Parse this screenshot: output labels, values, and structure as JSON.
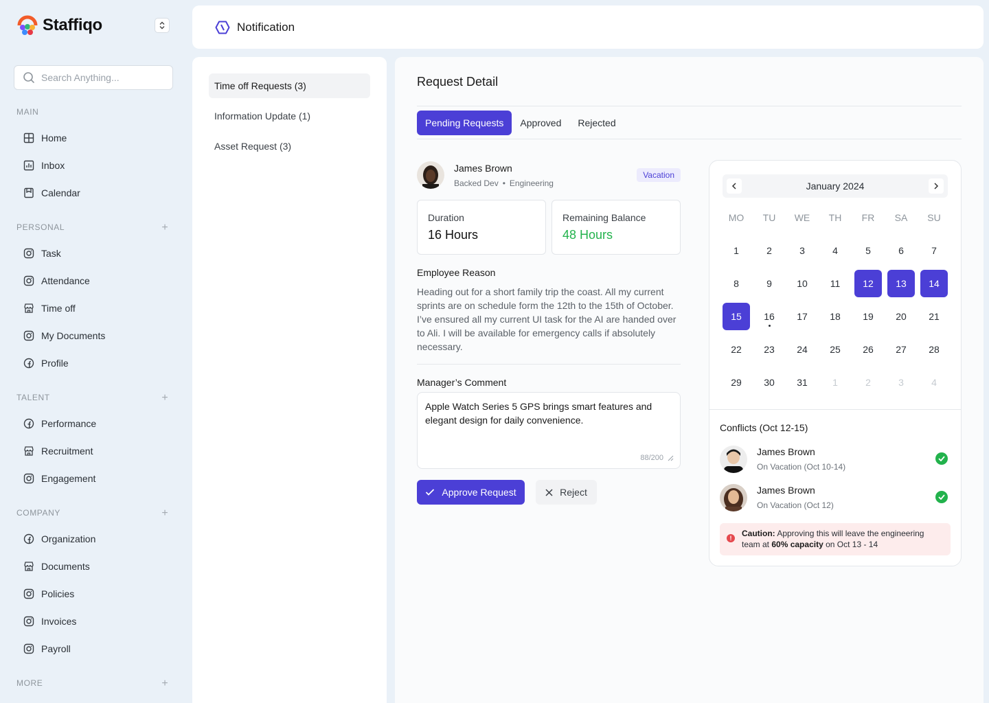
{
  "brand": {
    "name": "Staffiqo"
  },
  "search": {
    "placeholder": "Search Anything..."
  },
  "sidebar": {
    "sections": [
      {
        "label": "MAIN",
        "items": [
          {
            "label": "Home",
            "icon": "grid-icon"
          },
          {
            "label": "Inbox",
            "icon": "chart-icon"
          },
          {
            "label": "Calendar",
            "icon": "bookmark-icon"
          }
        ]
      },
      {
        "label": "PERSONAL",
        "items": [
          {
            "label": "Task",
            "icon": "camera-icon"
          },
          {
            "label": "Attendance",
            "icon": "camera-icon"
          },
          {
            "label": "Time off",
            "icon": "store-icon"
          },
          {
            "label": "My Documents",
            "icon": "camera-icon"
          },
          {
            "label": "Profile",
            "icon": "facebook-icon"
          }
        ]
      },
      {
        "label": "TALENT",
        "items": [
          {
            "label": "Performance",
            "icon": "facebook-icon"
          },
          {
            "label": "Recruitment",
            "icon": "store-icon"
          },
          {
            "label": "Engagement",
            "icon": "camera-icon"
          }
        ]
      },
      {
        "label": "COMPANY",
        "items": [
          {
            "label": "Organization",
            "icon": "facebook-icon"
          },
          {
            "label": "Documents",
            "icon": "store-icon"
          },
          {
            "label": "Policies",
            "icon": "camera-icon"
          },
          {
            "label": "Invoices",
            "icon": "camera-icon"
          },
          {
            "label": "Payroll",
            "icon": "camera-icon"
          }
        ]
      },
      {
        "label": "MORE",
        "items": []
      }
    ],
    "plus": "+"
  },
  "header": {
    "title": "Notification",
    "icon": "hexagon-icon"
  },
  "requests": {
    "items": [
      {
        "label": "Time off Requests (3)",
        "active": true
      },
      {
        "label": "Information Update (1)",
        "active": false
      },
      {
        "label": "Asset Request (3)",
        "active": false
      }
    ]
  },
  "detail": {
    "title": "Request Detail",
    "tabs": [
      {
        "label": "Pending Requests",
        "active": true
      },
      {
        "label": "Approved",
        "active": false
      },
      {
        "label": "Rejected",
        "active": false
      }
    ],
    "employee": {
      "name": "James Brown",
      "role": "Backed Dev",
      "separator": "•",
      "department": "Engineering",
      "badge": "Vacation"
    },
    "duration": {
      "label": "Duration",
      "value": "16 Hours"
    },
    "balance": {
      "label": "Remaining Balance",
      "value": "48 Hours"
    },
    "reason_label": "Employee Reason",
    "reason": "Heading out for a short family trip the coast. All my current sprints are on schedule form the 12th to the 15th of October. I’ve ensured all my current UI task for the AI are handed over to Ali. I will be available for emergency calls if absolutely necessary.",
    "comment_label": "Manager’s Comment",
    "comment": "Apple Watch Series 5 GPS brings smart features and elegant design for daily convenience.",
    "counter": "88/200",
    "approve_label": "Approve Request",
    "reject_label": "Reject"
  },
  "calendar": {
    "month": "January 2024",
    "weekdays": [
      "MO",
      "TU",
      "WE",
      "TH",
      "FR",
      "SA",
      "SU"
    ],
    "weeks": [
      [
        "1",
        "2",
        "3",
        "4",
        "5",
        "6",
        "7"
      ],
      [
        "8",
        "9",
        "10",
        "11",
        "12",
        "13",
        "14"
      ],
      [
        "15",
        "16",
        "17",
        "18",
        "19",
        "20",
        "21"
      ],
      [
        "22",
        "23",
        "24",
        "25",
        "26",
        "27",
        "28"
      ],
      [
        "29",
        "30",
        "31",
        "1",
        "2",
        "3",
        "4"
      ]
    ],
    "selected": [
      "12",
      "13",
      "14",
      "15"
    ],
    "dotted": "16",
    "muted_trailing": 4,
    "accent": "#4B3FD6"
  },
  "conflicts": {
    "title": "Conflicts (Oct 12-15)",
    "items": [
      {
        "name": "James Brown",
        "sub": "On Vacation (Oct 10-14)"
      },
      {
        "name": "James Brown",
        "sub": "On Vacation (Oct 12)"
      }
    ],
    "caution": {
      "icon_text": "!",
      "label": "Caution:",
      "text1": " Approving this will leave the engineering team at ",
      "emph": "60% capacity",
      "text2": " on Oct 13 - 14"
    }
  }
}
